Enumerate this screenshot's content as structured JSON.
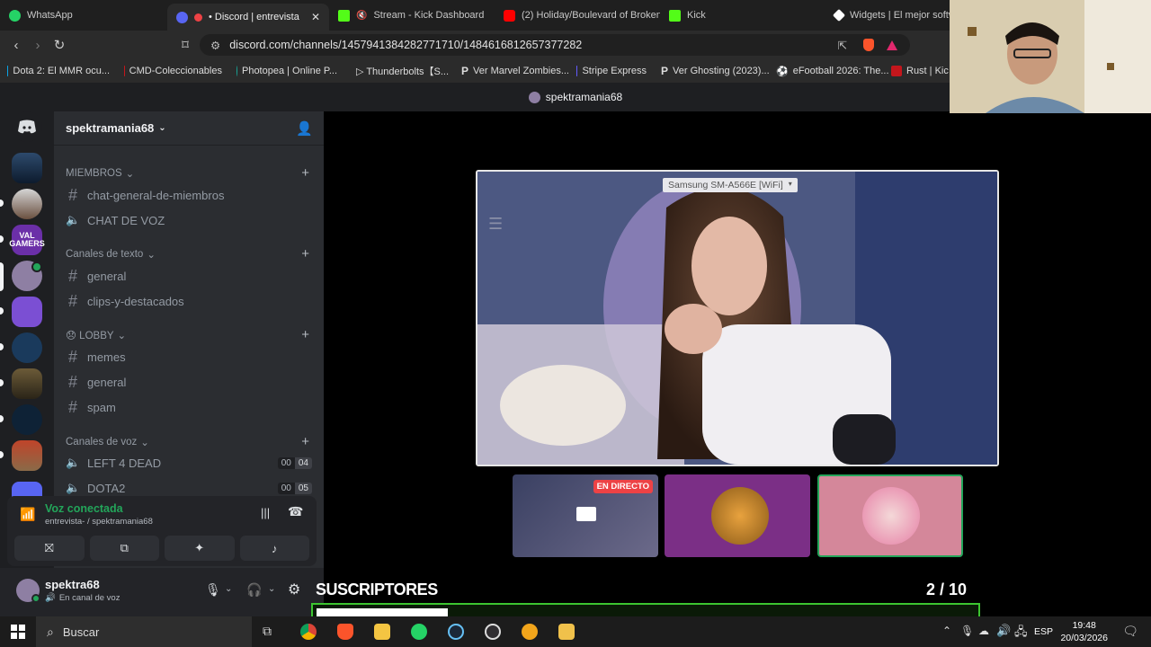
{
  "browser": {
    "tabs": [
      {
        "label": "WhatsApp",
        "color": "#25d366"
      },
      {
        "label": "• Discord | entrevista- | s",
        "color": "#5865f2",
        "active": true
      },
      {
        "label": "Stream - Kick Dashboard",
        "color": "#53fc18"
      },
      {
        "label": "(2) Holiday/Boulevard of Broken",
        "color": "#ff0000"
      },
      {
        "label": "Kick",
        "color": "#53fc18"
      },
      {
        "label": "Widgets | El mejor softw",
        "color": "#ffffff"
      }
    ],
    "url": "discord.com/channels/1457941384282771710/1484616812657377282",
    "bookmarks": [
      {
        "label": "Dota 2: El MMR ocu...",
        "color": "#0aa3e6"
      },
      {
        "label": "CMD-Coleccionables",
        "color": "#c4161c"
      },
      {
        "label": "Photopea | Online P...",
        "color": "#18a497"
      },
      {
        "label": "▷ Thunderbolts【S...",
        "color": "#e8e8e8"
      },
      {
        "label": "Ver Marvel Zombies...",
        "color": "#2b2b2b"
      },
      {
        "label": "Stripe Express",
        "color": "#635bff"
      },
      {
        "label": "Ver Ghosting (2023)...",
        "color": "#2b2b2b"
      },
      {
        "label": "eFootball 2026: The...",
        "color": "#2b2b2b"
      },
      {
        "label": "Rust | Kic",
        "color": "#c4161c"
      }
    ],
    "page_title": "spektramania68"
  },
  "discord": {
    "server_name": "spektramania68",
    "categories": {
      "miembros": "MIEMBROS",
      "texto": "Canales de texto",
      "lobby": "😞 LOBBY",
      "voz": "Canales de voz"
    },
    "channels": {
      "chat_general": "chat-general-de-miembros",
      "chat_voz": "CHAT DE VOZ",
      "general": "general",
      "clips": "clips-y-destacados",
      "memes": "memes",
      "general2": "general",
      "spam": "spam",
      "left4dead": "LEFT 4 DEAD",
      "dota2": "DOTA2"
    },
    "voice_counts": {
      "l4d_a": "00",
      "l4d_b": "04",
      "dota_a": "00",
      "dota_b": "05"
    },
    "voice_status": "Voz conectada",
    "voice_location": "entrevista- / spektramania68",
    "user": {
      "name": "spektra68",
      "status": "En canal de voz"
    },
    "stream": {
      "source_label": "Samsung SM-A566E [WiFi]",
      "live_badge": "EN DIRECTO"
    }
  },
  "overlay": {
    "title": "SUSCRIPTORES",
    "count": "2  / 10",
    "progress": 0.2
  },
  "taskbar": {
    "search_placeholder": "Buscar",
    "lang": "ESP",
    "time": "19:48",
    "date": "20/03/2026"
  }
}
